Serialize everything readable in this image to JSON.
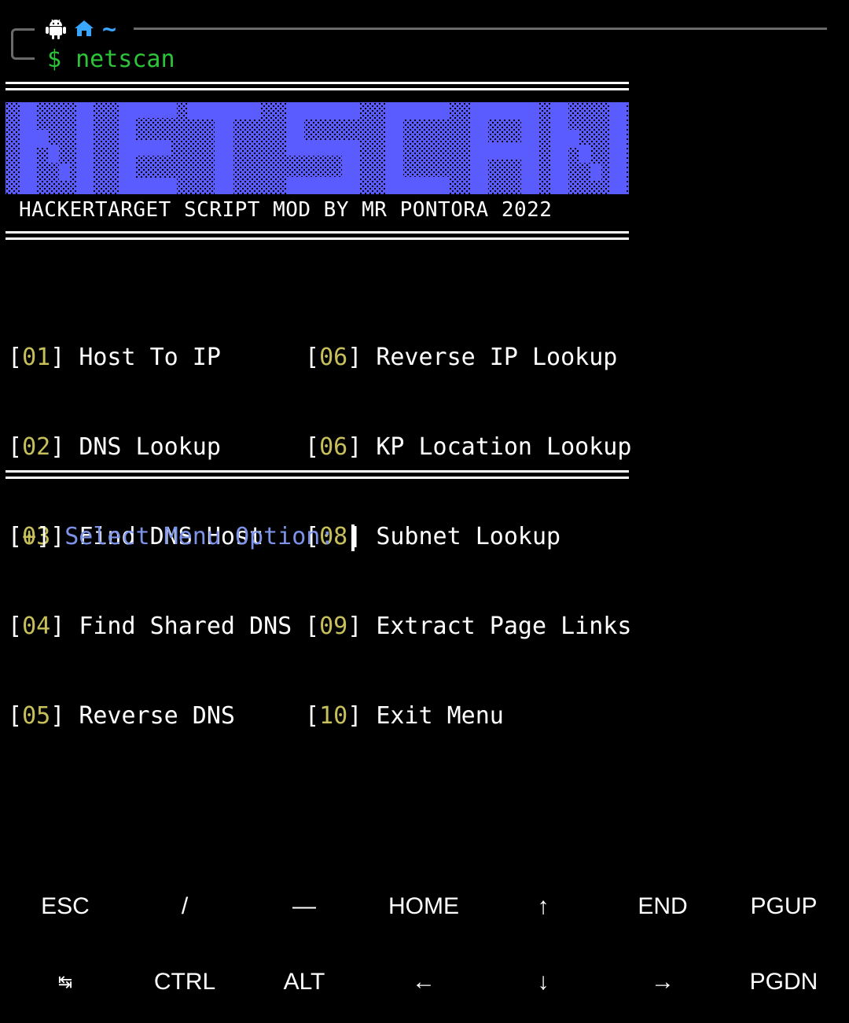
{
  "prompt": {
    "symbol": "$",
    "command": "netscan",
    "tilde": "~"
  },
  "banner": {
    "title": "NETSCAN",
    "subtitle": "HACKERTARGET SCRIPT MOD BY MR PONTORA 2022",
    "color": "#5a5cff"
  },
  "menu": {
    "left": [
      {
        "num": "01",
        "label": "Host To IP"
      },
      {
        "num": "02",
        "label": "DNS Lookup"
      },
      {
        "num": "03",
        "label": "Find DNS Host"
      },
      {
        "num": "04",
        "label": "Find Shared DNS"
      },
      {
        "num": "05",
        "label": "Reverse DNS"
      }
    ],
    "right": [
      {
        "num": "06",
        "label": "Reverse IP Lookup"
      },
      {
        "num": "06",
        "label": "KP Location Lookup"
      },
      {
        "num": "08",
        "label": "Subnet Lookup"
      },
      {
        "num": "09",
        "label": "Extract Page Links"
      },
      {
        "num": "10",
        "label": "Exit Menu"
      }
    ]
  },
  "select": {
    "marker": "+",
    "text": "Select Menu Option:"
  },
  "keyboard": {
    "row1": [
      "ESC",
      "/",
      "—",
      "HOME",
      "↑",
      "END",
      "PGUP"
    ],
    "row2": [
      "↹",
      "CTRL",
      "ALT",
      "←",
      "↓",
      "→",
      "PGDN"
    ]
  },
  "colors": {
    "green": "#2ec43a",
    "yellow": "#c7c05a",
    "blue": "#7c93e8",
    "cyan": "#3aa6ff"
  }
}
